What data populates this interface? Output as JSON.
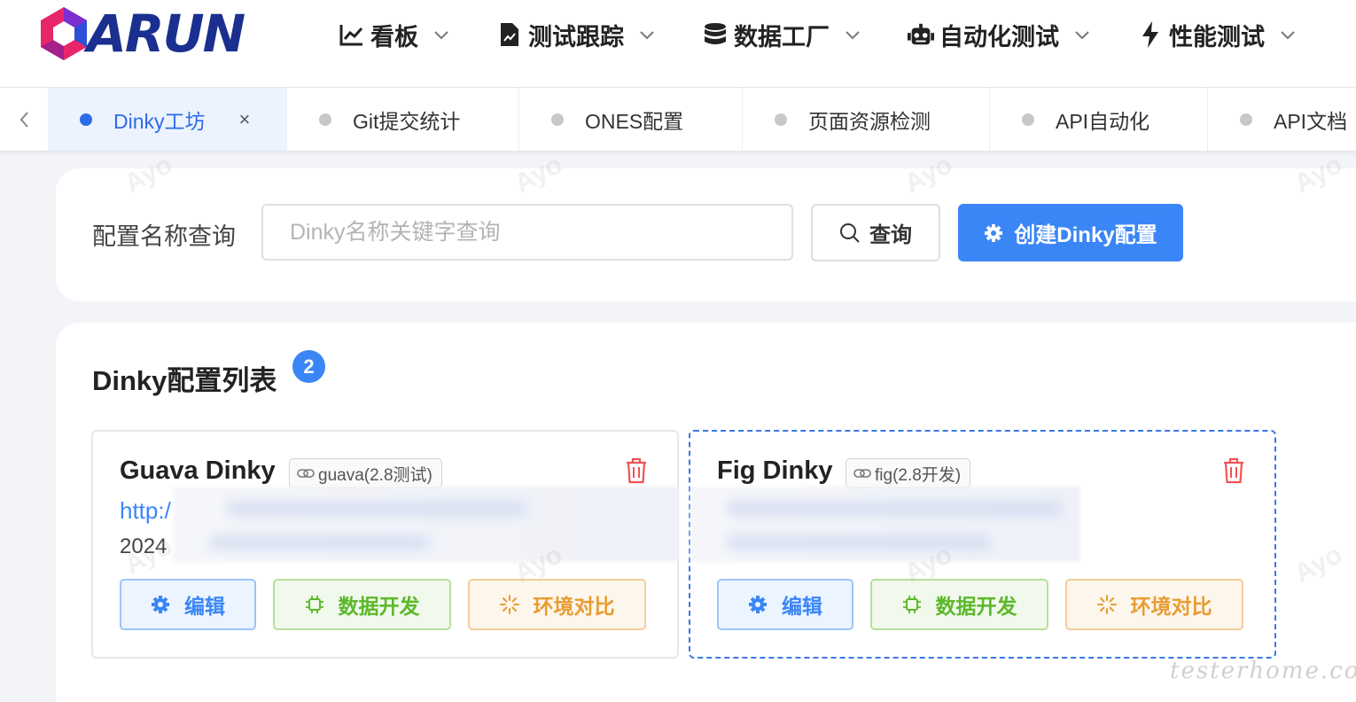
{
  "logo": {
    "text": "ARUN"
  },
  "nav": [
    {
      "label": "看板",
      "icon": "line-chart-icon"
    },
    {
      "label": "测试跟踪",
      "icon": "document-icon"
    },
    {
      "label": "数据工厂",
      "icon": "database-icon"
    },
    {
      "label": "自动化测试",
      "icon": "robot-icon"
    },
    {
      "label": "性能测试",
      "icon": "lightning-icon"
    }
  ],
  "tabs": [
    {
      "label": "Dinky工坊",
      "active": true,
      "close": "×"
    },
    {
      "label": "Git提交统计"
    },
    {
      "label": "ONES配置"
    },
    {
      "label": "页面资源检测"
    },
    {
      "label": "API自动化"
    },
    {
      "label": "API文档"
    }
  ],
  "search": {
    "label": "配置名称查询",
    "placeholder": "Dinky名称关键字查询",
    "value": "",
    "query_label": "查询",
    "create_label": "创建Dinky配置"
  },
  "list": {
    "title": "Dinky配置列表",
    "count": "2",
    "items": [
      {
        "name": "Guava Dinky",
        "tag": "guava(2.8测试)",
        "url": "http:/",
        "date": "2024",
        "edit_label": "编辑",
        "dev_label": "数据开发",
        "compare_label": "环境对比"
      },
      {
        "name": "Fig Dinky",
        "tag": "fig(2.8开发)",
        "url": "",
        "date": "",
        "edit_label": "编辑",
        "dev_label": "数据开发",
        "compare_label": "环境对比"
      }
    ]
  },
  "watermark": {
    "user": "Ayo",
    "site": "testerhome.com"
  },
  "colors": {
    "primary": "#3a86f6",
    "success": "#5cb82a",
    "warning": "#e89c31",
    "danger": "#f05454"
  }
}
